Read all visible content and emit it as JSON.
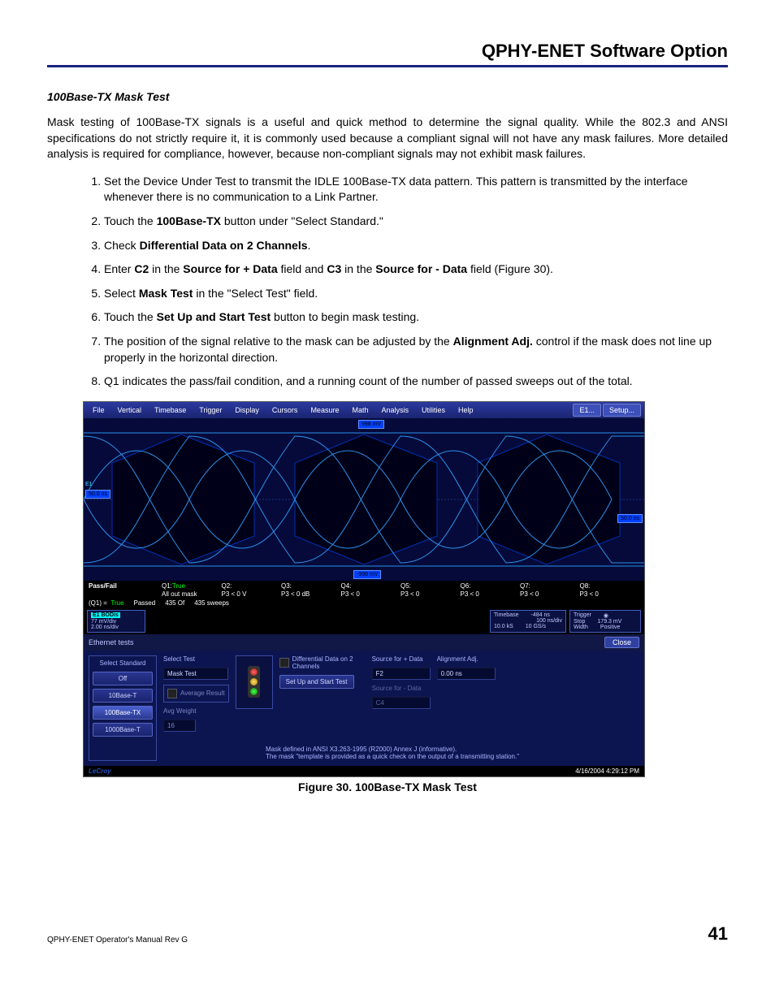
{
  "header": {
    "title": "QPHY-ENET Software Option"
  },
  "section": {
    "title": "100Base-TX Mask Test"
  },
  "intro": "Mask testing of 100Base-TX signals is a useful and quick method to determine the signal quality. While the 802.3 and ANSI specifications do not strictly require it, it is commonly used because a compliant signal will not have any mask failures. More detailed analysis is required for compliance, however, because non-compliant signals may not exhibit mask failures.",
  "steps": {
    "s1": "Set the Device Under Test to transmit the IDLE 100Base-TX data pattern. This pattern is transmitted by the interface whenever there is no communication to a Link Partner.",
    "s2a": "Touch the ",
    "s2b": "100Base-TX",
    "s2c": " button under \"Select Standard.\"",
    "s3a": "Check ",
    "s3b": "Differential Data on 2 Channels",
    "s3c": ".",
    "s4a": "Enter ",
    "s4b": "C2",
    "s4c": " in the ",
    "s4d": "Source for + Data",
    "s4e": " field and ",
    "s4f": "C3",
    "s4g": " in the ",
    "s4h": "Source for - Data",
    "s4i": " field (Figure 30).",
    "s5a": "Select ",
    "s5b": "Mask Test",
    "s5c": " in the \"Select Test\" field.",
    "s6a": "Touch the ",
    "s6b": "Set Up and Start Test",
    "s6c": " button to begin mask testing.",
    "s7a": "The position of the signal relative to the mask can be adjusted by the ",
    "s7b": "Alignment Adj.",
    "s7c": " control if the mask does not line up properly in the horizontal direction.",
    "s8": "Q1 indicates the pass/fail condition, and a running count of the number of passed sweeps out of the total."
  },
  "figure": {
    "caption": "Figure 30. 100Base-TX Mask Test"
  },
  "footer": {
    "manual": "QPHY-ENET Operator's Manual Rev G",
    "page": "41"
  },
  "scope": {
    "menu": [
      "File",
      "Vertical",
      "Timebase",
      "Trigger",
      "Display",
      "Cursors",
      "Measure",
      "Math",
      "Analysis",
      "Utilities",
      "Help"
    ],
    "e1": "E1...",
    "setup": "Setup...",
    "topLabel": "998 mV",
    "leftLabel": "50.0 ns",
    "rightLabel": "50.0 ns",
    "botLabel": "-998 mV",
    "passfail": {
      "title": "Pass/Fail",
      "row1": [
        "Q1:",
        "Q2:",
        "Q3:",
        "Q4:",
        "Q5:",
        "Q6:",
        "Q7:",
        "Q8:"
      ],
      "q1v": "True",
      "row2_label": "All out mask",
      "row2": [
        "P3 < 0 V",
        "P3 < 0 dB",
        "P3 < 0",
        "P3 < 0",
        "P3 < 0",
        "P3 < 0",
        "P3 < 0"
      ],
      "q1line": "(Q1) =",
      "q1val": "True",
      "passed": "Passed",
      "passcount": "435  Of",
      "sweeps": "435  sweeps"
    },
    "chan": {
      "hdr": "E1 BODis",
      "l1": "77 mV/div",
      "l2": "2.00 ns/div"
    },
    "timebase": {
      "title": "Timebase",
      "v1": "-484 ns",
      "v2": "100 ns/div",
      "v3": "10.0 kS",
      "v4": "10 GS/s"
    },
    "trigger": {
      "title": "Trigger",
      "v1": "Stop",
      "v2": "179.3 mV",
      "v3": "Width",
      "v4": "Positive"
    },
    "panelTitle": "Ethernet tests",
    "close": "Close",
    "selectStandard": "Select Standard",
    "stdOff": "Off",
    "std10": "10Base-T",
    "std100": "100Base-TX",
    "std1000": "1000Base-T",
    "selectTest": "Select Test",
    "maskTest": "Mask Test",
    "avgResult": "Average Result",
    "avgWeight": "Avg Weight",
    "avgWeightVal": "16",
    "diffData": "Differential Data on 2 Channels",
    "setupStart": "Set Up and Start Test",
    "srcPlus": "Source for + Data",
    "srcPlusVal": "F2",
    "srcMinus": "Source for - Data",
    "srcMinusVal": "C4",
    "alignAdj": "Alignment Adj.",
    "alignVal": "0.00 ns",
    "note1": "Mask defined in ANSI X3.263-1995 (R2000) Annex J (informative).",
    "note2": "The mask \"template is provided as a quick check on the output of a transmitting station.\"",
    "brand": "LeCroy",
    "time": "4/16/2004 4:29:12 PM"
  }
}
